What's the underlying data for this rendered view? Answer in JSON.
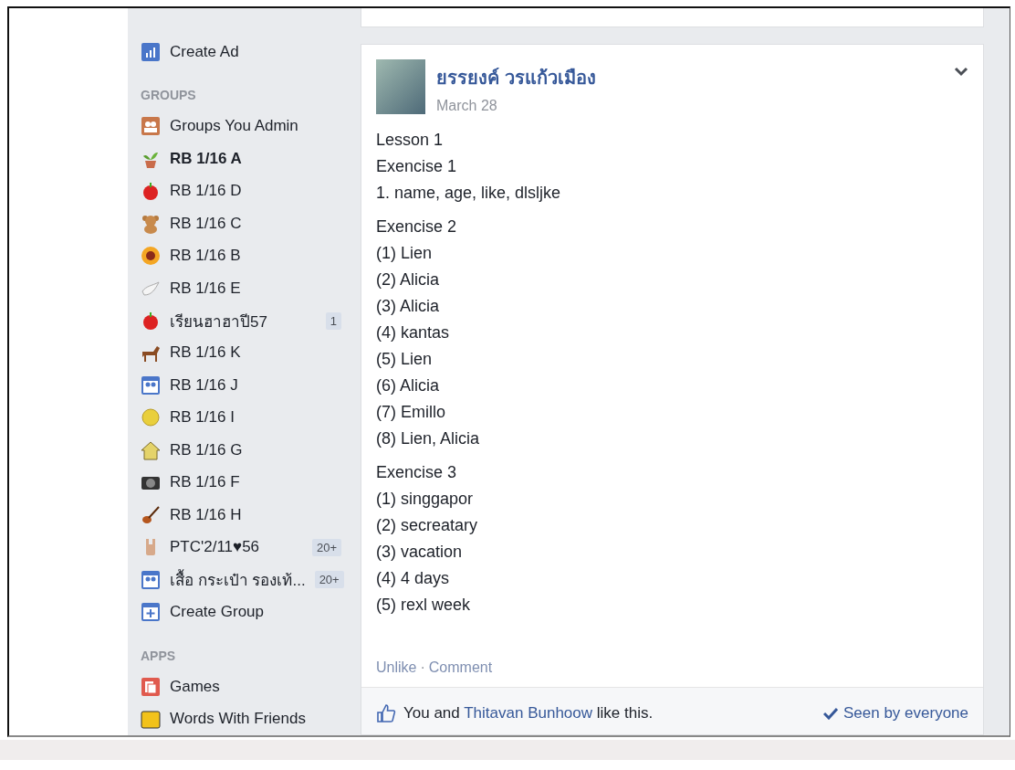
{
  "sidebar": {
    "top_items": [
      {
        "label": "Create Ad"
      }
    ],
    "groups_heading": "GROUPS",
    "groups": [
      {
        "label": "Groups You Admin",
        "selected": false
      },
      {
        "label": "RB 1/16 A",
        "selected": true
      },
      {
        "label": "RB 1/16 D",
        "selected": false
      },
      {
        "label": "RB 1/16 C",
        "selected": false
      },
      {
        "label": "RB 1/16 B",
        "selected": false
      },
      {
        "label": "RB 1/16 E",
        "selected": false
      },
      {
        "label": "เรียนฮาฮาปี57",
        "selected": false,
        "badge": "1"
      },
      {
        "label": "RB 1/16 K",
        "selected": false
      },
      {
        "label": "RB 1/16 J",
        "selected": false
      },
      {
        "label": "RB 1/16 I",
        "selected": false
      },
      {
        "label": "RB 1/16 G",
        "selected": false
      },
      {
        "label": "RB 1/16 F",
        "selected": false
      },
      {
        "label": "RB 1/16 H",
        "selected": false
      },
      {
        "label": "PTC'2/11♥56",
        "selected": false,
        "badge": "20+"
      },
      {
        "label": "เสื้อ กระเป๋า รองเท้...",
        "selected": false,
        "badge": "20+"
      },
      {
        "label": "Create Group",
        "selected": false
      }
    ],
    "apps_heading": "APPS",
    "apps": [
      {
        "label": "Games"
      },
      {
        "label": "Words With Friends"
      }
    ]
  },
  "post": {
    "author": "ยรรยงค์ วรแก้วเมือง",
    "date": "March 28",
    "paragraphs": [
      [
        "Lesson 1",
        "Exencise 1",
        "1. name, age, like, dlsljke"
      ],
      [
        "Exencise 2",
        "(1) Lien",
        "(2) Alicia",
        "(3) Alicia",
        "(4) kantas",
        "(5) Lien",
        "(6) Alicia",
        "(7) Emillo",
        "(8) Lien, Alicia"
      ],
      [
        "Exencise 3",
        "(1) singgapor",
        "(2) secreatary",
        "(3) vacation",
        "(4) 4 days",
        "(5) rexl week"
      ]
    ],
    "actions": [
      "Unlike",
      "Comment"
    ],
    "action_separator": "·",
    "likes": {
      "prefix": "You and",
      "link": "Thitavan Bunhoow",
      "suffix": "like this."
    },
    "seen": "Seen by everyone"
  }
}
